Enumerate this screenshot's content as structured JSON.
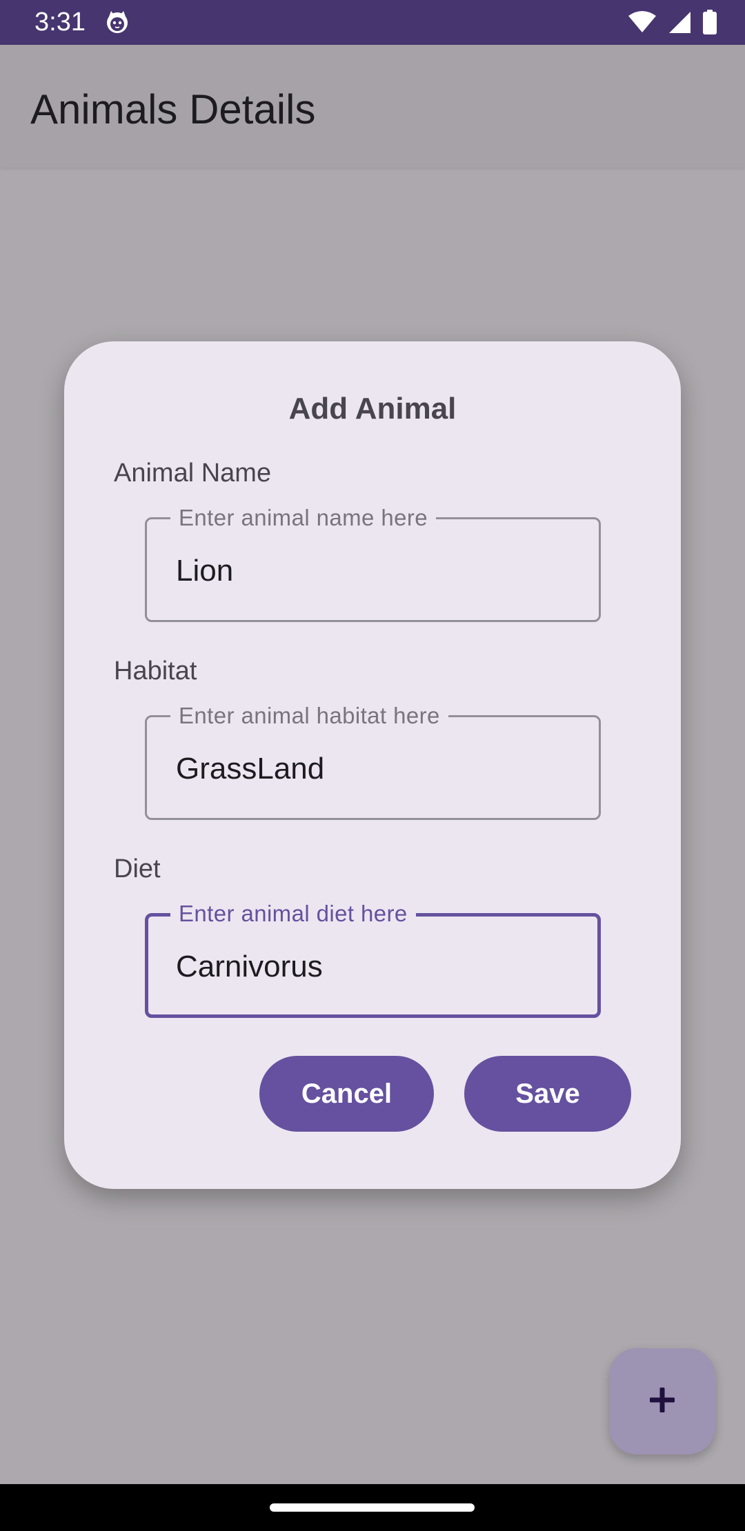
{
  "status_bar": {
    "time": "3:31",
    "app_icon": "cat-face-icon",
    "icons": [
      "wifi-icon",
      "cell-signal-icon",
      "battery-icon"
    ]
  },
  "app_bar": {
    "title": "Animals Details"
  },
  "dialog": {
    "title": "Add Animal",
    "fields": [
      {
        "label": "Animal Name",
        "placeholder": "Enter animal name here",
        "value": "Lion",
        "focused": false
      },
      {
        "label": "Habitat",
        "placeholder": "Enter animal habitat here",
        "value": "GrassLand",
        "focused": false
      },
      {
        "label": "Diet",
        "placeholder": "Enter animal diet here",
        "value": "Carnivorus",
        "focused": true
      }
    ],
    "cancel_label": "Cancel",
    "save_label": "Save"
  },
  "fab": {
    "icon": "plus-icon"
  },
  "colors": {
    "status_bar": "#46356f",
    "primary": "#65519f",
    "dialog_bg": "#ece6f0",
    "scrim_bg": "#aca8ad"
  }
}
